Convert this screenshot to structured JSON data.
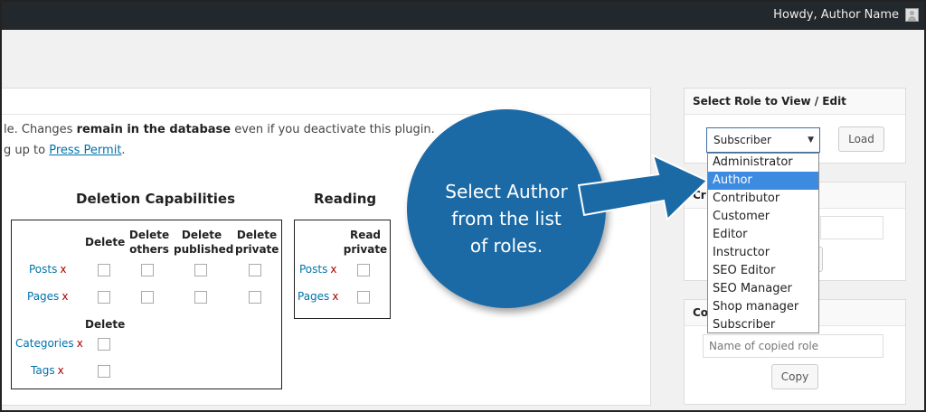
{
  "topbar": {
    "greeting": "Howdy, Author Name"
  },
  "intro": {
    "line1_pre": "le. Changes ",
    "line1_bold": "remain in the database",
    "line1_post": " even if you deactivate this plugin.",
    "line2_pre": "g up to ",
    "line2_link": "Press Permit",
    "line2_post": "."
  },
  "deletion": {
    "title": "Deletion Capabilities",
    "headers": [
      "Delete",
      "Delete others",
      "Delete published",
      "Delete private"
    ],
    "rows": [
      {
        "label": "Posts",
        "x": "x"
      },
      {
        "label": "Pages",
        "x": "x"
      }
    ],
    "sub_header": "Delete",
    "tax_rows": [
      {
        "label": "Categories",
        "x": "x"
      },
      {
        "label": "Tags",
        "x": "x"
      }
    ]
  },
  "reading": {
    "title": "Reading",
    "header": "Read private",
    "rows": [
      {
        "label": "Posts",
        "x": "x"
      },
      {
        "label": "Pages",
        "x": "x"
      }
    ]
  },
  "select_role": {
    "title": "Select Role to View / Edit",
    "selected": "Subscriber",
    "load_label": "Load",
    "options": [
      "Administrator",
      "Author",
      "Contributor",
      "Customer",
      "Editor",
      "Instructor",
      "SEO Editor",
      "SEO Manager",
      "Shop manager",
      "Subscriber"
    ],
    "highlighted_index": 1
  },
  "create_panel": {
    "title_visible": "Cr"
  },
  "copy_panel": {
    "title_visible": "Co",
    "placeholder": "Name of copied role",
    "copy_label": "Copy"
  },
  "callout": {
    "line1": "Select Author",
    "line2": "from the list",
    "line3": "of roles."
  },
  "colors": {
    "callout": "#1b6aa6",
    "highlight": "#3d8be0",
    "topbar": "#23282d",
    "link": "#0073aa"
  }
}
